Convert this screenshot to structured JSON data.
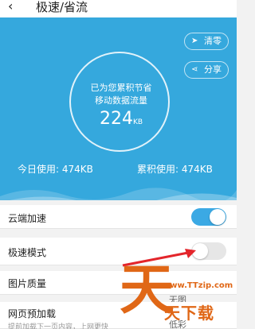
{
  "header": {
    "back_icon": "chevron-left-icon",
    "title": "极速/省流"
  },
  "hero": {
    "bg": "#35a8dd",
    "line1": "已为您累积节省",
    "line2": "移动数据流量",
    "value": "224",
    "unit": "KB",
    "clear_label": "清零",
    "share_label": "分享",
    "today_label": "今日使用: 474KB",
    "total_label": "累积使用: 474KB"
  },
  "settings": {
    "cloud_label": "云端加速",
    "cloud_on": true,
    "speed_label": "极速模式",
    "speed_on": false,
    "image_label": "图片质量",
    "image_hint": "无图",
    "preload_label": "网页预加载",
    "preload_sub": "提前加载下一页内容，上网更快",
    "preload_hint": "低彩"
  },
  "watermark": {
    "logo": "天",
    "url": "www.TTzip.com",
    "name": "天下载",
    "color": "#e06716"
  }
}
